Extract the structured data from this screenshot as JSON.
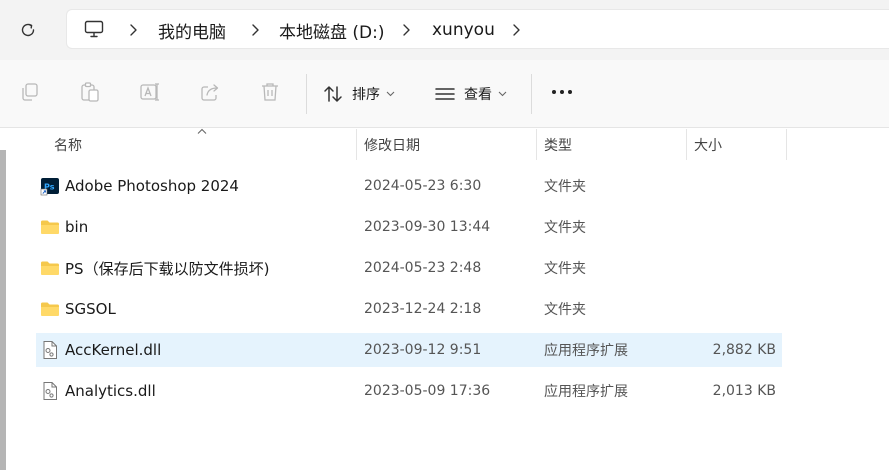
{
  "address_bar": {
    "crumbs": [
      "我的电脑",
      "本地磁盘 (D:)",
      "xunyou"
    ]
  },
  "toolbar": {
    "sort_label": "排序",
    "view_label": "查看"
  },
  "columns": {
    "name": "名称",
    "modified": "修改日期",
    "type": "类型",
    "size": "大小"
  },
  "files": [
    {
      "name": "Adobe Photoshop 2024",
      "modified": "2024-05-23 6:30",
      "type": "文件夹",
      "size": "",
      "icon": "photoshop-shortcut-icon"
    },
    {
      "name": "bin",
      "modified": "2023-09-30 13:44",
      "type": "文件夹",
      "size": "",
      "icon": "folder-icon"
    },
    {
      "name": "PS（保存后下载以防文件损坏)",
      "modified": "2024-05-23 2:48",
      "type": "文件夹",
      "size": "",
      "icon": "folder-icon"
    },
    {
      "name": "SGSOL",
      "modified": "2023-12-24 2:18",
      "type": "文件夹",
      "size": "",
      "icon": "folder-icon"
    },
    {
      "name": "AccKernel.dll",
      "modified": "2023-09-12 9:51",
      "type": "应用程序扩展",
      "size": "2,882 KB",
      "icon": "dll-file-icon",
      "selected": true
    },
    {
      "name": "Analytics.dll",
      "modified": "2023-05-09 17:36",
      "type": "应用程序扩展",
      "size": "2,013 KB",
      "icon": "dll-file-icon"
    }
  ],
  "colors": {
    "selected_row": "#e5f3fd",
    "folder": "#f5c84c",
    "photoshop_blue": "#31a8ff",
    "photoshop_bg": "#001e36"
  }
}
